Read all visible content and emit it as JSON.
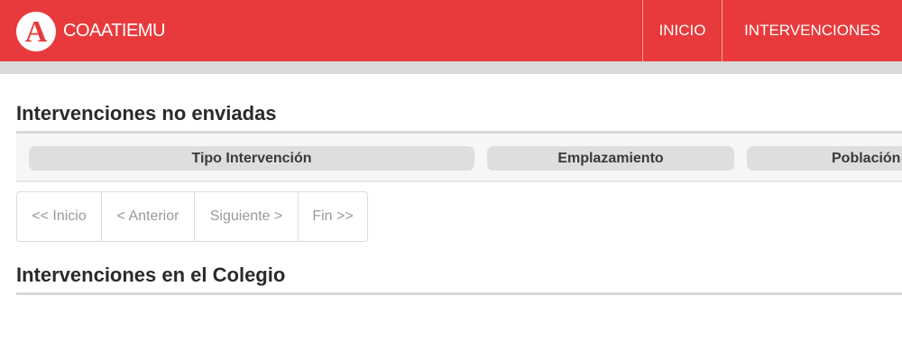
{
  "header": {
    "logo_letter": "A",
    "brand": "COAATIEMU",
    "nav": [
      {
        "label": "INICIO"
      },
      {
        "label": "INTERVENCIONES"
      }
    ],
    "colors": {
      "accent": "#e83a3c"
    }
  },
  "section_unsent": {
    "title": "Intervenciones no enviadas",
    "columns": [
      "Tipo Intervención",
      "Emplazamiento",
      "Población"
    ]
  },
  "pager": {
    "first": "<< Inicio",
    "prev": "< Anterior",
    "next": "Siguiente >",
    "last": "Fin >>"
  },
  "section_college": {
    "title": "Intervenciones en el Colegio"
  }
}
